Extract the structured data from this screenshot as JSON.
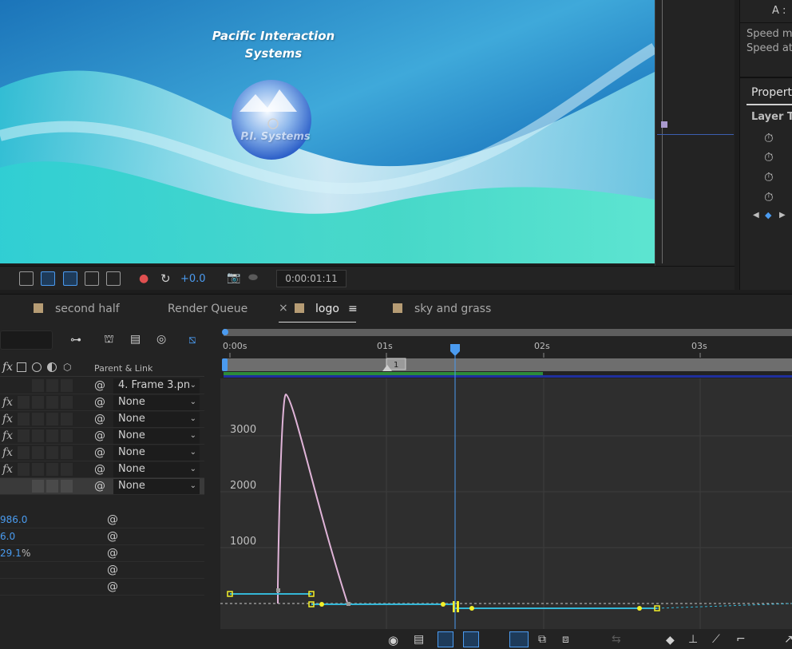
{
  "viewer": {
    "logo_line1": "Pacific Interaction",
    "logo_line2": "Systems",
    "logo_emblem": "P.I. Systems"
  },
  "side_panel": {
    "label": "A :"
  },
  "right_panel": {
    "speed_line1": "Speed mi",
    "speed_line2": "Speed at",
    "properties_tab": "Properti",
    "layer_section": "Layer Tr"
  },
  "viewer_toolbar": {
    "exposure_value": "+0.0",
    "timecode": "0:00:01:11"
  },
  "tabs": [
    {
      "label": "second half",
      "has_swatch": true
    },
    {
      "label": "Render Queue",
      "has_swatch": false
    },
    {
      "label": "logo",
      "has_swatch": true,
      "active": true
    },
    {
      "label": "sky and grass",
      "has_swatch": true
    }
  ],
  "tab_close_symbol": "×",
  "tab_menu_symbol": "≡",
  "layer_panel": {
    "parent_header": "Parent & Link",
    "fx_symbol": "fx",
    "spiral_symbol": "@",
    "layers": [
      {
        "parent": "4. Frame 3.pn",
        "has_fx": false,
        "selected": false
      },
      {
        "parent": "None",
        "has_fx": true,
        "selected": false
      },
      {
        "parent": "None",
        "has_fx": true,
        "selected": false
      },
      {
        "parent": "None",
        "has_fx": true,
        "selected": false
      },
      {
        "parent": "None",
        "has_fx": true,
        "selected": false
      },
      {
        "parent": "None",
        "has_fx": true,
        "selected": false
      },
      {
        "parent": "None",
        "has_fx": false,
        "selected": true
      }
    ],
    "property_values": [
      "986.0",
      "6.0",
      "29.1",
      "",
      ""
    ],
    "property_unit": "%"
  },
  "graph": {
    "time_labels": [
      "0:00s",
      "01s",
      "02s",
      "03s"
    ],
    "value_labels": [
      "3000",
      "2000",
      "1000"
    ],
    "work_area_marker": "1",
    "cti_time": "0:00:01:11"
  },
  "colors": {
    "accent_blue": "#4b9bf0",
    "curve_pink": "#e0b4d8",
    "curve_cyan": "#34b6d6",
    "keyframe_yellow": "#f2ef2a",
    "tab_swatch": "#b69c74"
  }
}
